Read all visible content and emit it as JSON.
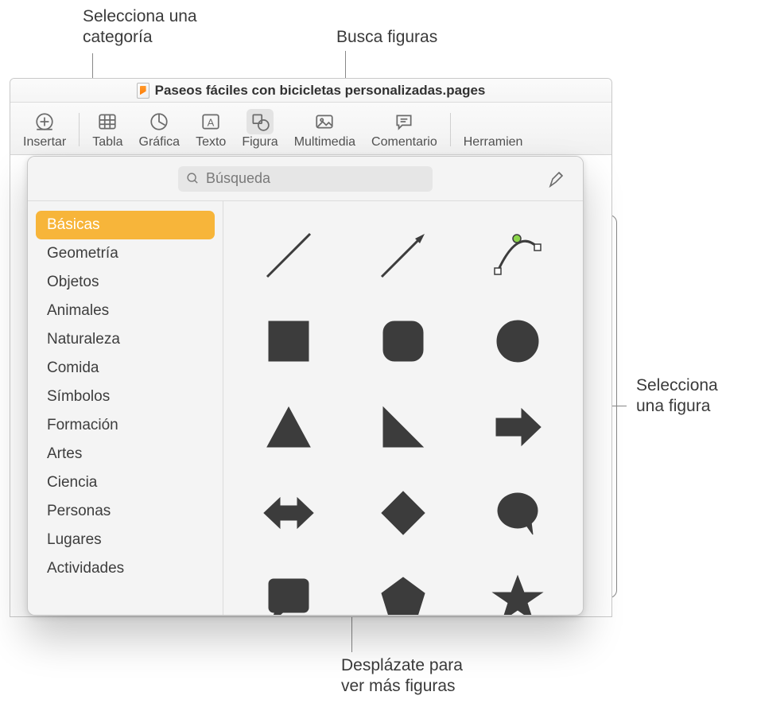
{
  "callouts": {
    "category": "Selecciona una\ncategoría",
    "search": "Busca figuras",
    "shape": "Selecciona\nuna figura",
    "scroll": "Desplázate para\nver más figuras"
  },
  "window": {
    "title": "Paseos fáciles con bicicletas personalizadas.pages"
  },
  "toolbar": {
    "items": [
      {
        "label": "Insertar"
      },
      {
        "label": "Tabla"
      },
      {
        "label": "Gráfica"
      },
      {
        "label": "Texto"
      },
      {
        "label": "Figura"
      },
      {
        "label": "Multimedia"
      },
      {
        "label": "Comentario"
      },
      {
        "label": "Herramien"
      }
    ],
    "active_index": 4
  },
  "popover": {
    "search_placeholder": "Búsqueda",
    "categories": [
      "Básicas",
      "Geometría",
      "Objetos",
      "Animales",
      "Naturaleza",
      "Comida",
      "Símbolos",
      "Formación",
      "Artes",
      "Ciencia",
      "Personas",
      "Lugares",
      "Actividades"
    ],
    "selected_category_index": 0,
    "shapes": [
      "line",
      "arrow-line",
      "bezier-curve",
      "square",
      "rounded-square",
      "circle",
      "triangle",
      "right-triangle",
      "arrow-right",
      "double-arrow",
      "diamond",
      "speech-bubble",
      "callout-rect",
      "pentagon",
      "star"
    ]
  }
}
